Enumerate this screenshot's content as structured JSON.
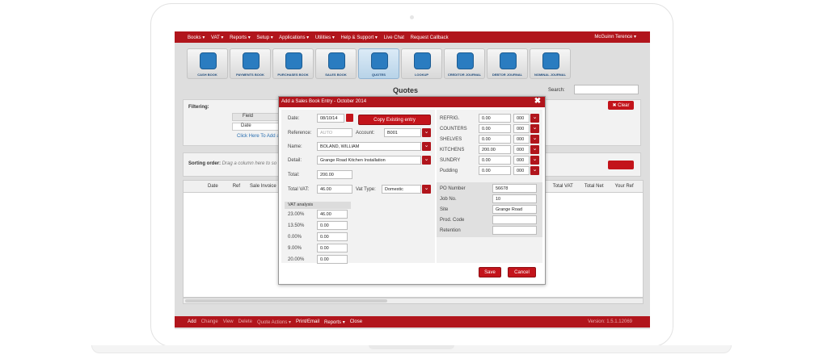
{
  "menu": {
    "items": [
      "Books ▾",
      "VAT ▾",
      "Reports ▾",
      "Setup ▾",
      "Applications ▾",
      "Utilities ▾",
      "Help & Support ▾",
      "Live Chat",
      "Request Callback"
    ],
    "user": "McGuinn Terence ▾"
  },
  "tiles": [
    {
      "label": "CASH BOOK",
      "icon": "bar-chart-icon"
    },
    {
      "label": "PAYMENTS BOOK",
      "icon": "card-icon"
    },
    {
      "label": "PURCHASES BOOK",
      "icon": "calculator-icon"
    },
    {
      "label": "SALES BOOK",
      "icon": "register-icon"
    },
    {
      "label": "QUOTES",
      "icon": "quote-icon"
    },
    {
      "label": "LOOKUP",
      "icon": "flashlight-icon"
    },
    {
      "label": "CREDITOR JOURNAL",
      "icon": "chart-icon"
    },
    {
      "label": "DEBTOR JOURNAL",
      "icon": "people-icon"
    },
    {
      "label": "NOMINAL JOURNAL",
      "icon": "binders-icon"
    }
  ],
  "page": {
    "title": "Quotes",
    "search_label": "Search:"
  },
  "filter": {
    "label": "Filtering:",
    "field_header": "Field",
    "date_row": "Date",
    "add_link": "Click Here To Add a Fil",
    "clear_label": "Clear"
  },
  "sorting": {
    "label": "Sorting order:",
    "hint": "Drag a column here to so"
  },
  "grid": {
    "columns_left": [
      "Date",
      "Ref",
      "Sale Invoice"
    ],
    "columns_right": [
      "Total VAT",
      "Total Net",
      "Your Ref"
    ]
  },
  "bottom": {
    "add": "Add",
    "change": "Change",
    "view": "View",
    "delete": "Delete",
    "quote_actions": "Quote Actions ▾",
    "print_email": "Print/Email",
    "reports": "Reports ▾",
    "close": "Close",
    "version": "Version: 1.5.1.12069"
  },
  "modal": {
    "title": "Add a Sales Book Entry - October 2014",
    "date_label": "Date:",
    "date_value": "08/10/14",
    "copy_button": "Copy Existing entry",
    "reference_label": "Reference:",
    "reference_value": "AUTO",
    "account_label": "Account:",
    "account_value": "B001",
    "name_label": "Name:",
    "name_value": "BOLAND, WILLIAM",
    "detail_label": "Detail:",
    "detail_value": "Grange Road Kitchen Installation",
    "total_label": "Total:",
    "total_value": "200.00",
    "total_vat_label": "Total VAT:",
    "total_vat_value": "46.00",
    "vat_type_label": "Vat Type:",
    "vat_type_value": "Domestic",
    "vat_analysis_header": "VAT analysis",
    "vat_rates": [
      {
        "rate": "23.00%",
        "value": "46.00"
      },
      {
        "rate": "13.50%",
        "value": "0.00"
      },
      {
        "rate": "0.00%",
        "value": "0.00"
      },
      {
        "rate": "9.00%",
        "value": "0.00"
      },
      {
        "rate": "20.00%",
        "value": "0.00"
      }
    ],
    "categories": [
      {
        "label": "REFRIG.",
        "value": "0.00",
        "code": "000"
      },
      {
        "label": "COUNTERS",
        "value": "0.00",
        "code": "000"
      },
      {
        "label": "SHELVES",
        "value": "0.00",
        "code": "000"
      },
      {
        "label": "KITCHENS",
        "value": "200.00",
        "code": "000"
      },
      {
        "label": "SUNDRY",
        "value": "0.00",
        "code": "000"
      },
      {
        "label": "Pudding",
        "value": "0.00",
        "code": "000"
      }
    ],
    "extra": [
      {
        "label": "PO Number",
        "value": "56678"
      },
      {
        "label": "Job No.",
        "value": "10"
      },
      {
        "label": "Site",
        "value": "Grange Road"
      },
      {
        "label": "Prod. Code",
        "value": ""
      },
      {
        "label": "Retention",
        "value": ""
      }
    ],
    "save_button": "Save",
    "cancel_button": "Cancel"
  },
  "colors": {
    "brand_red": "#b1151c",
    "tile_blue": "#2a7cc0"
  }
}
